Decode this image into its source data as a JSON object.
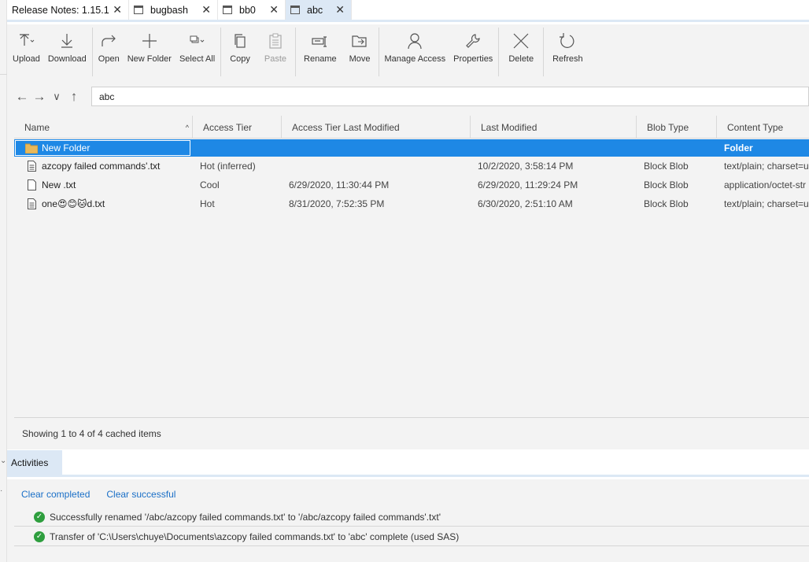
{
  "tabs": [
    {
      "label": "Release Notes: 1.15.1",
      "has_icon": false,
      "active": false
    },
    {
      "label": "bugbash",
      "has_icon": true,
      "active": false
    },
    {
      "label": "bb0",
      "has_icon": true,
      "active": false
    },
    {
      "label": "abc",
      "has_icon": true,
      "active": true
    }
  ],
  "tab_close_glyph": "✕",
  "toolbar": {
    "upload": "Upload",
    "download": "Download",
    "open": "Open",
    "new_folder": "New Folder",
    "select_all": "Select All",
    "copy": "Copy",
    "paste": "Paste",
    "rename": "Rename",
    "move": "Move",
    "manage_access": "Manage Access",
    "properties": "Properties",
    "delete": "Delete",
    "refresh": "Refresh"
  },
  "nav": {
    "back": "←",
    "forward": "→",
    "recent": "∨",
    "up": "↑",
    "path": "abc"
  },
  "table": {
    "columns": [
      "Name",
      "Access Tier",
      "Access Tier Last Modified",
      "Last Modified",
      "Blob Type",
      "Content Type"
    ],
    "sort_glyph": "^",
    "rows": [
      {
        "name": "New Folder",
        "icon": "folder-icon",
        "access_tier": "",
        "tier_modified": "",
        "last_modified": "",
        "blob_type": "",
        "content_type": "Folder",
        "selected": true
      },
      {
        "name": "azcopy failed commands'.txt",
        "icon": "text-file-icon",
        "access_tier": "Hot (inferred)",
        "tier_modified": "",
        "last_modified": "10/2/2020, 3:58:14 PM",
        "blob_type": "Block Blob",
        "content_type": "text/plain; charset=u",
        "selected": false
      },
      {
        "name": "New .txt",
        "icon": "blank-file-icon",
        "access_tier": "Cool",
        "tier_modified": "6/29/2020, 11:30:44 PM",
        "last_modified": "6/29/2020, 11:29:24 PM",
        "blob_type": "Block Blob",
        "content_type": "application/octet-str",
        "selected": false
      },
      {
        "name": "one😍😊🐱d.txt",
        "icon": "text-file-icon",
        "access_tier": "Hot",
        "tier_modified": "8/31/2020, 7:52:35 PM",
        "last_modified": "6/30/2020, 2:51:10 AM",
        "blob_type": "Block Blob",
        "content_type": "text/plain; charset=u",
        "selected": false
      }
    ]
  },
  "status_text": "Showing 1 to 4 of 4 cached items",
  "activities": {
    "tab_label": "Activities",
    "clear_completed": "Clear completed",
    "clear_successful": "Clear successful",
    "items": [
      "Successfully renamed '/abc/azcopy failed commands.txt' to '/abc/azcopy failed commands'.txt'",
      "Transfer of 'C:\\Users\\chuye\\Documents\\azcopy failed commands.txt' to 'abc' complete (used SAS)"
    ]
  },
  "colors": {
    "selection": "#1e88e5",
    "tab_active": "#dce8f5",
    "link": "#1a6fc7",
    "success": "#2e9e3e"
  }
}
